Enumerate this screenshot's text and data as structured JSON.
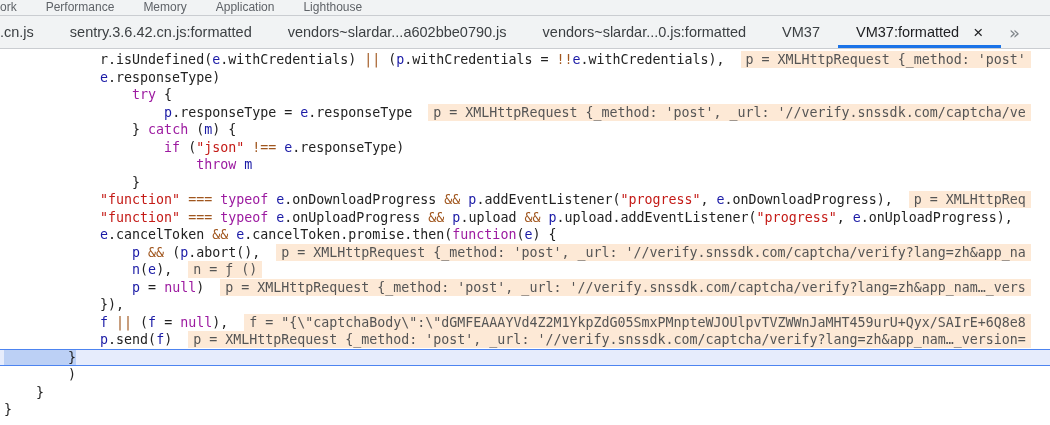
{
  "panel_tabs": [
    {
      "label": "ork"
    },
    {
      "label": "Performance"
    },
    {
      "label": "Memory"
    },
    {
      "label": "Application"
    },
    {
      "label": "Lighthouse"
    }
  ],
  "file_tabs": [
    {
      "label": ".cn.js",
      "selected": false
    },
    {
      "label": "sentry.3.6.42.cn.js:formatted",
      "selected": false
    },
    {
      "label": "vendors~slardar...a602bbe0790.js",
      "selected": false
    },
    {
      "label": "vendors~slardar...0.js:formatted",
      "selected": false
    },
    {
      "label": "VM37",
      "selected": false
    },
    {
      "label": "VM37:formatted",
      "selected": true,
      "close": "×"
    }
  ],
  "overflow_button": "»",
  "code_lines": [
    {
      "current": false,
      "tokens": [
        {
          "text": "            r.isUndefined(",
          "kind": "plain"
        },
        {
          "text": "e",
          "kind": "var"
        },
        {
          "text": ".withCredentials) ",
          "kind": "plain"
        },
        {
          "text": "||",
          "kind": "op"
        },
        {
          "text": " (",
          "kind": "plain"
        },
        {
          "text": "p",
          "kind": "var"
        },
        {
          "text": ".withCredentials = ",
          "kind": "plain"
        },
        {
          "text": "!!",
          "kind": "op"
        },
        {
          "text": "e",
          "kind": "var"
        },
        {
          "text": ".withCredentials),",
          "kind": "plain"
        }
      ],
      "inline_value": "p = XMLHttpRequest {_method: 'post'"
    },
    {
      "current": false,
      "tokens": [
        {
          "text": "            e",
          "kind": "var"
        },
        {
          "text": ".responseType)",
          "kind": "plain"
        }
      ]
    },
    {
      "current": false,
      "tokens": [
        {
          "text": "                try",
          "kind": "keyword"
        },
        {
          "text": " {",
          "kind": "plain"
        }
      ]
    },
    {
      "current": false,
      "tokens": [
        {
          "text": "                    p",
          "kind": "var"
        },
        {
          "text": ".responseType = ",
          "kind": "plain"
        },
        {
          "text": "e",
          "kind": "var"
        },
        {
          "text": ".responseType",
          "kind": "plain"
        }
      ],
      "inline_value": "p = XMLHttpRequest {_method: 'post', _url: '//verify.snssdk.com/captcha/ve"
    },
    {
      "current": false,
      "tokens": [
        {
          "text": "                } ",
          "kind": "plain"
        },
        {
          "text": "catch",
          "kind": "keyword"
        },
        {
          "text": " (",
          "kind": "plain"
        },
        {
          "text": "m",
          "kind": "var"
        },
        {
          "text": ") {",
          "kind": "plain"
        }
      ]
    },
    {
      "current": false,
      "tokens": [
        {
          "text": "                    if",
          "kind": "keyword"
        },
        {
          "text": " (",
          "kind": "plain"
        },
        {
          "text": "\"json\" ",
          "kind": "string"
        },
        {
          "text": "!== ",
          "kind": "op"
        },
        {
          "text": "e",
          "kind": "var"
        },
        {
          "text": ".responseType)",
          "kind": "plain"
        }
      ]
    },
    {
      "current": false,
      "tokens": [
        {
          "text": "                        throw ",
          "kind": "keyword"
        },
        {
          "text": "m",
          "kind": "var"
        }
      ]
    },
    {
      "current": false,
      "tokens": [
        {
          "text": "                }",
          "kind": "plain"
        }
      ]
    },
    {
      "current": false,
      "tokens": [
        {
          "text": "            \"function\" ",
          "kind": "string"
        },
        {
          "text": "=== ",
          "kind": "op"
        },
        {
          "text": "typeof ",
          "kind": "keyword"
        },
        {
          "text": "e",
          "kind": "var"
        },
        {
          "text": ".onDownloadProgress ",
          "kind": "plain"
        },
        {
          "text": "&& ",
          "kind": "op"
        },
        {
          "text": "p",
          "kind": "var"
        },
        {
          "text": ".addEventListener(",
          "kind": "plain"
        },
        {
          "text": "\"progress\"",
          "kind": "string"
        },
        {
          "text": ", ",
          "kind": "plain"
        },
        {
          "text": "e",
          "kind": "var"
        },
        {
          "text": ".onDownloadProgress),",
          "kind": "plain"
        }
      ],
      "inline_value": "p = XMLHttpReq"
    },
    {
      "current": false,
      "tokens": [
        {
          "text": "            \"function\" ",
          "kind": "string"
        },
        {
          "text": "=== ",
          "kind": "op"
        },
        {
          "text": "typeof ",
          "kind": "keyword"
        },
        {
          "text": "e",
          "kind": "var"
        },
        {
          "text": ".onUploadProgress ",
          "kind": "plain"
        },
        {
          "text": "&& ",
          "kind": "op"
        },
        {
          "text": "p",
          "kind": "var"
        },
        {
          "text": ".upload ",
          "kind": "plain"
        },
        {
          "text": "&& ",
          "kind": "op"
        },
        {
          "text": "p",
          "kind": "var"
        },
        {
          "text": ".upload.addEventListener(",
          "kind": "plain"
        },
        {
          "text": "\"progress\"",
          "kind": "string"
        },
        {
          "text": ", ",
          "kind": "plain"
        },
        {
          "text": "e",
          "kind": "var"
        },
        {
          "text": ".onUploadProgress),",
          "kind": "plain"
        }
      ]
    },
    {
      "current": false,
      "tokens": [
        {
          "text": "            e",
          "kind": "var"
        },
        {
          "text": ".cancelToken ",
          "kind": "plain"
        },
        {
          "text": "&& ",
          "kind": "op"
        },
        {
          "text": "e",
          "kind": "var"
        },
        {
          "text": ".cancelToken.promise.then(",
          "kind": "plain"
        },
        {
          "text": "function",
          "kind": "keyword"
        },
        {
          "text": "(",
          "kind": "plain"
        },
        {
          "text": "e",
          "kind": "var"
        },
        {
          "text": ") {",
          "kind": "plain"
        }
      ]
    },
    {
      "current": false,
      "tokens": [
        {
          "text": "                p ",
          "kind": "var"
        },
        {
          "text": "&&",
          "kind": "op"
        },
        {
          "text": " (",
          "kind": "plain"
        },
        {
          "text": "p",
          "kind": "var"
        },
        {
          "text": ".abort(),",
          "kind": "plain"
        }
      ],
      "inline_value": "p = XMLHttpRequest {_method: 'post', _url: '//verify.snssdk.com/captcha/verify?lang=zh&app_na"
    },
    {
      "current": false,
      "tokens": [
        {
          "text": "                n",
          "kind": "var"
        },
        {
          "text": "(",
          "kind": "plain"
        },
        {
          "text": "e",
          "kind": "var"
        },
        {
          "text": "),",
          "kind": "plain"
        }
      ],
      "inline_value": "n = ƒ ()"
    },
    {
      "current": false,
      "tokens": [
        {
          "text": "                p",
          "kind": "var"
        },
        {
          "text": " = ",
          "kind": "plain"
        },
        {
          "text": "null",
          "kind": "keyword"
        },
        {
          "text": ")",
          "kind": "plain"
        }
      ],
      "inline_value": "p = XMLHttpRequest {_method: 'post', _url: '//verify.snssdk.com/captcha/verify?lang=zh&app_nam…_vers"
    },
    {
      "current": false,
      "tokens": [
        {
          "text": "            }),",
          "kind": "plain"
        }
      ]
    },
    {
      "current": false,
      "tokens": [
        {
          "text": "            f ",
          "kind": "var"
        },
        {
          "text": "||",
          "kind": "op"
        },
        {
          "text": " (",
          "kind": "plain"
        },
        {
          "text": "f",
          "kind": "var"
        },
        {
          "text": " = ",
          "kind": "plain"
        },
        {
          "text": "null",
          "kind": "keyword"
        },
        {
          "text": "),",
          "kind": "plain"
        }
      ],
      "inline_value": "f = \"{\\\"captchaBody\\\":\\\"dGMFEAAAYVd4Z2M1YkpZdG05SmxPMnpteWJOUlpvTVZWWnJaMHT459urU+Qyx/SAIrE+6Q8e8"
    },
    {
      "current": false,
      "tokens": [
        {
          "text": "            p",
          "kind": "var"
        },
        {
          "text": ".send(",
          "kind": "plain"
        },
        {
          "text": "f",
          "kind": "var"
        },
        {
          "text": ")",
          "kind": "plain"
        }
      ],
      "inline_value": "p = XMLHttpRequest {_method: 'post', _url: '//verify.snssdk.com/captcha/verify?lang=zh&app_nam…_version="
    },
    {
      "current": true,
      "tokens": [
        {
          "text": "        }",
          "kind": "selection"
        }
      ]
    },
    {
      "current": false,
      "tokens": [
        {
          "text": "        )",
          "kind": "plain"
        }
      ]
    },
    {
      "current": false,
      "tokens": [
        {
          "text": "    }",
          "kind": "plain"
        }
      ]
    },
    {
      "current": false,
      "tokens": [
        {
          "text": "}",
          "kind": "plain"
        }
      ]
    }
  ]
}
